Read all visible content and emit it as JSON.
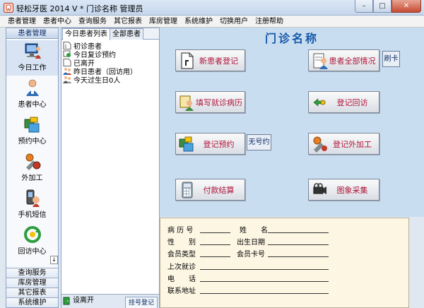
{
  "window": {
    "title": "轻松牙医 2014 V  *  门诊名称  管理员",
    "controls": {
      "minimize": "–",
      "maximize": "□",
      "close": "✕"
    }
  },
  "menu": [
    "患者管理",
    "患者中心",
    "查询服务",
    "其它报表",
    "库房管理",
    "系统维护",
    "切换用户",
    "注册帮助"
  ],
  "leftnav": {
    "header": "患者管理",
    "items": [
      {
        "label": "今日工作",
        "icon": "computer-user-icon"
      },
      {
        "label": "患者中心",
        "icon": "patient-icon"
      },
      {
        "label": "预约中心",
        "icon": "appointment-icon"
      },
      {
        "label": "外加工",
        "icon": "processing-icon"
      },
      {
        "label": "手机短信",
        "icon": "mobile-sms-icon"
      },
      {
        "label": "回访中心",
        "icon": "callback-icon"
      }
    ],
    "scroll_glyph": "↓",
    "bottom": [
      "查询服务",
      "库房管理",
      "其它报表",
      "系统维护"
    ]
  },
  "midpanel": {
    "tabs": [
      "今日患者列表",
      "全部患者"
    ],
    "tree": [
      {
        "label": "初诊患者",
        "icon": "new-document-icon"
      },
      {
        "label": "今日复诊预约",
        "icon": "return-visit-icon"
      },
      {
        "label": "已离开",
        "icon": "document-icon"
      },
      {
        "label": "昨日患者（回访用）",
        "icon": "people-icon"
      },
      {
        "label": "今天过生日0人",
        "icon": "birthday-icon"
      }
    ],
    "footer": {
      "settings": "设离开",
      "register": "挂号登记"
    }
  },
  "main": {
    "title": "门诊名称",
    "buttons": {
      "register_new": "新患者登记",
      "all_info": "患者全部情况",
      "fill_record": "填写就诊病历",
      "callback": "登记回访",
      "appointment": "登记预约",
      "external": "登记外加工",
      "payment": "付款结算",
      "image": "图象采集"
    },
    "card_button": "刷卡",
    "no_number_button": "无号约"
  },
  "info": {
    "record_no": "病 历 号",
    "name": "姓　　名",
    "gender": "性　　别",
    "birthday": "出生日期",
    "member_type": "会员类型",
    "member_card": "会员卡号",
    "last_visit": "上次就诊",
    "phone": "电　　话",
    "address": "联系地址"
  }
}
